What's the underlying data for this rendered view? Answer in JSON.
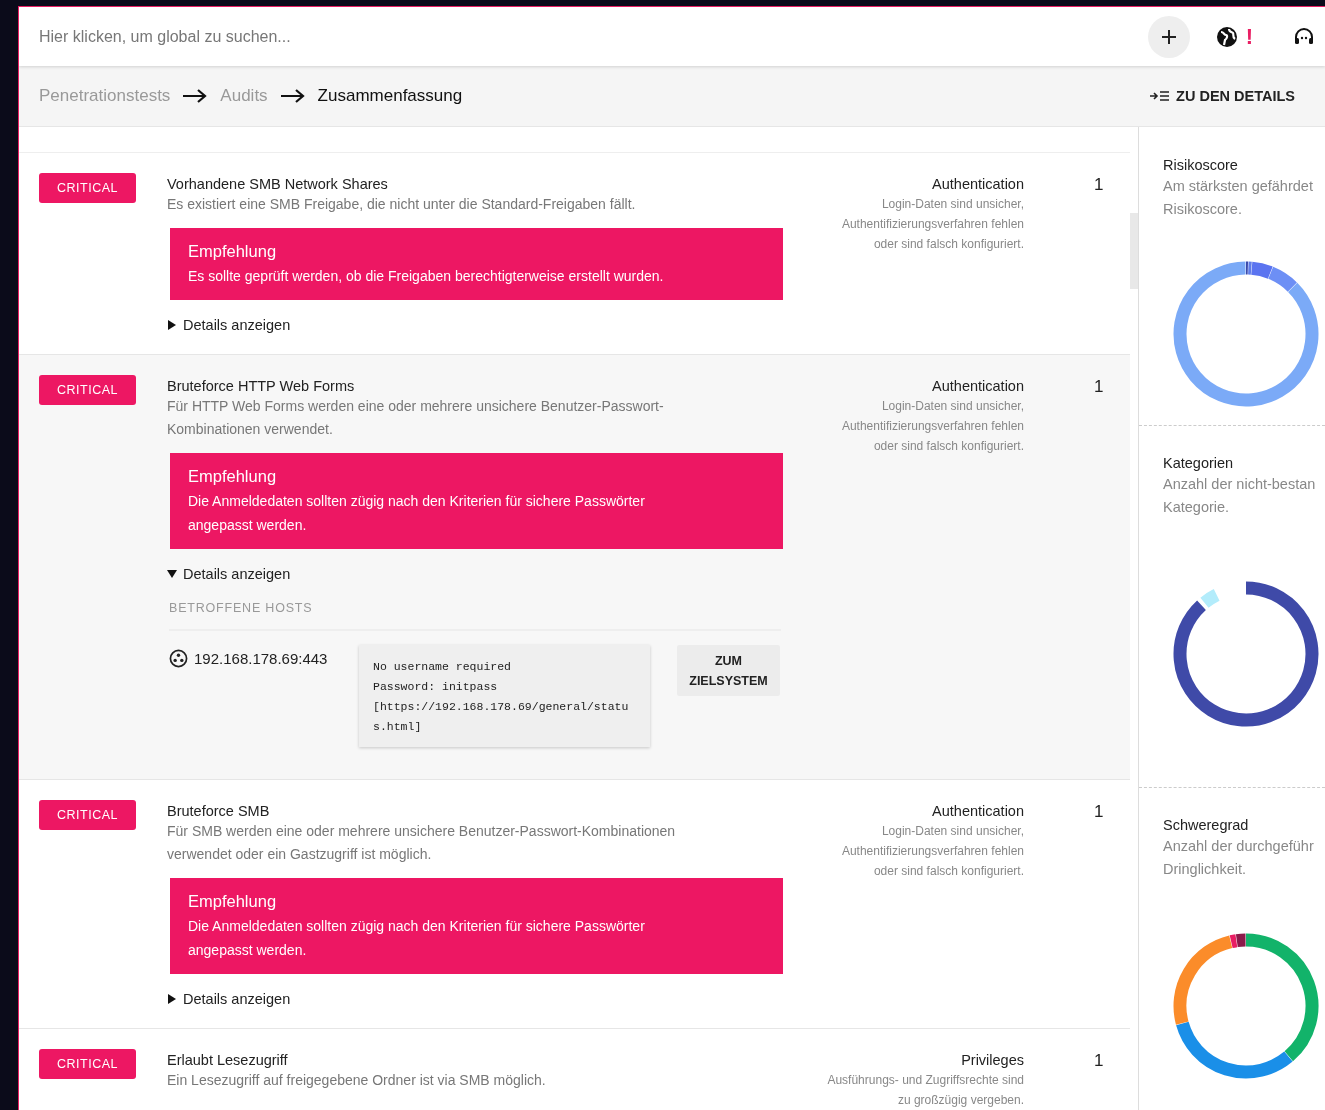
{
  "search": {
    "placeholder": "Hier klicken, um global zu suchen..."
  },
  "toolbar": {
    "alert": "!"
  },
  "breadcrumb": [
    {
      "label": "Penetrationstests",
      "current": false
    },
    {
      "label": "Audits",
      "current": false
    },
    {
      "label": "Zusammenfassung",
      "current": true
    }
  ],
  "details_link": "ZU DEN DETAILS",
  "findings": [
    {
      "severity": "CRITICAL",
      "title": "Vorhandene SMB Network Shares",
      "description": "Es existiert eine SMB Freigabe, die nicht unter die Standard-Freigaben fällt.",
      "recommendation": {
        "title": "Empfehlung",
        "text": "Es sollte geprüft werden, ob die Freigaben berechtigterweise erstellt wurden."
      },
      "details": {
        "label": "Details anzeigen",
        "expanded": false
      },
      "category": "Authentication",
      "category_description": "Login-Daten sind unsicher, Authentifizierungsverfahren fehlen oder sind falsch konfiguriert.",
      "count": "1"
    },
    {
      "severity": "CRITICAL",
      "title": "Bruteforce HTTP Web Forms",
      "description": "Für HTTP Web Forms werden eine oder mehrere unsichere Benutzer-Passwort-Kombinationen verwendet.",
      "recommendation": {
        "title": "Empfehlung",
        "text": "Die Anmeldedaten sollten zügig nach den Kriterien für sichere Passwörter angepasst werden."
      },
      "details": {
        "label": "Details anzeigen",
        "expanded": true,
        "hosts_heading": "BETROFFENE HOSTS",
        "hosts": [
          {
            "address": "192.168.178.69:443",
            "evidence": "No username required\nPassword: initpass\n[https://192.168.178.69/general/status.html]",
            "action": "ZUM ZIELSYSTEM"
          }
        ]
      },
      "category": "Authentication",
      "category_description": "Login-Daten sind unsicher, Authentifizierungsverfahren fehlen oder sind falsch konfiguriert.",
      "count": "1"
    },
    {
      "severity": "CRITICAL",
      "title": "Bruteforce SMB",
      "description": "Für SMB werden eine oder mehrere unsichere Benutzer-Passwort-Kombinationen verwendet oder ein Gastzugriff ist möglich.",
      "recommendation": {
        "title": "Empfehlung",
        "text": "Die Anmeldedaten sollten zügig nach den Kriterien für sichere Passwörter angepasst werden."
      },
      "details": {
        "label": "Details anzeigen",
        "expanded": false
      },
      "category": "Authentication",
      "category_description": "Login-Daten sind unsicher, Authentifizierungsverfahren fehlen oder sind falsch konfiguriert.",
      "count": "1"
    },
    {
      "severity": "CRITICAL",
      "title": "Erlaubt Lesezugriff",
      "description": "Ein Lesezugriff auf freigegebene Ordner ist via SMB möglich.",
      "category": "Privileges",
      "category_description": "Ausführungs- und Zugriffsrechte sind zu großzügig vergeben.",
      "count": "1"
    }
  ],
  "panels": [
    {
      "title": "Risikoscore",
      "description": "Am stärksten gefährdet\nRisikoscore."
    },
    {
      "title": "Kategorien",
      "description": "Anzahl der nicht-bestan\nKategorie."
    },
    {
      "title": "Schweregrad",
      "description": "Anzahl der durchgeführ\nDringlichkeit."
    }
  ]
}
